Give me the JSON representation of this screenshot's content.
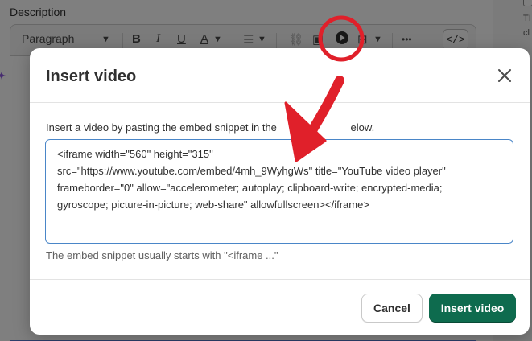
{
  "page": {
    "description_label": "Description",
    "toolbar": {
      "paragraph_label": "Paragraph",
      "bold": "B",
      "italic": "I",
      "underline": "U",
      "text_color": "A",
      "more": "•••",
      "code_view": "</>"
    },
    "right_text_1": "TI",
    "right_text_2": "cl"
  },
  "modal": {
    "title": "Insert video",
    "instructions": "Insert a video by pasting the embed snippet in the",
    "instructions_tail": "elow.",
    "embed_snippet": "<iframe width=\"560\" height=\"315\"\nsrc=\"https://www.youtube.com/embed/4mh_9WyhgWs\" title=\"YouTube video player\"\nframeborder=\"0\" allow=\"accelerometer; autoplay; clipboard-write; encrypted-media;\ngyroscope; picture-in-picture; web-share\" allowfullscreen></iframe>",
    "help_text": "The embed snippet usually starts with \"<iframe ...\"",
    "cancel_label": "Cancel",
    "insert_label": "Insert video"
  },
  "icons": {
    "close": "close-icon",
    "insert_video": "play-circle-icon",
    "arrow": "red-arrow-annotation",
    "highlight": "red-circle-annotation"
  },
  "colors": {
    "primary_button": "#0e6b4e",
    "annotation": "#e0202a",
    "focus_border": "#4a86c8"
  }
}
